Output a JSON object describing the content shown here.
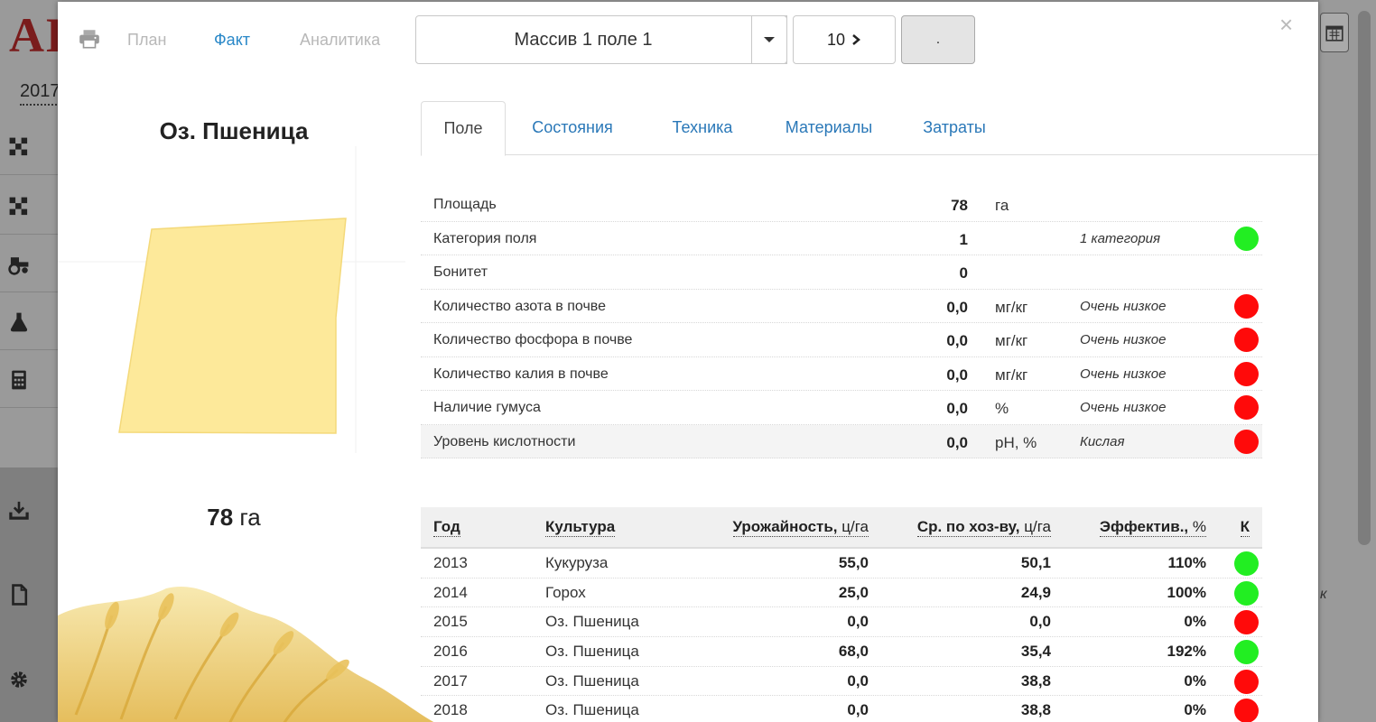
{
  "background": {
    "logo": "АК",
    "year": "2017",
    "side_note": "к"
  },
  "topbar": {
    "nav": [
      "План",
      "Факт",
      "Аналитика"
    ],
    "active_nav": "Факт",
    "field_select": "Массив 1 поле 1",
    "number_button": "10",
    "dot_button": ".",
    "close": "×"
  },
  "left_panel": {
    "crop": "Оз. Пшеница",
    "area_value": "78",
    "area_unit": "га",
    "field_color": "#fde99a"
  },
  "tabs": [
    "Поле",
    "Состояния",
    "Техника",
    "Материалы",
    "Затраты"
  ],
  "active_tab": "Поле",
  "properties": [
    {
      "label": "Площадь",
      "value": "78",
      "unit": "га",
      "note": "",
      "status": ""
    },
    {
      "label": "Категория поля",
      "value": "1",
      "unit": "",
      "note": "1 категория",
      "status": "green"
    },
    {
      "label": "Бонитет",
      "value": "0",
      "unit": "",
      "note": "",
      "status": ""
    },
    {
      "label": "Количество азота в почве",
      "value": "0,0",
      "unit": "мг/кг",
      "note": "Очень низкое",
      "status": "red"
    },
    {
      "label": "Количество фосфора в почве",
      "value": "0,0",
      "unit": "мг/кг",
      "note": "Очень низкое",
      "status": "red"
    },
    {
      "label": "Количество калия в почве",
      "value": "0,0",
      "unit": "мг/кг",
      "note": "Очень низкое",
      "status": "red"
    },
    {
      "label": "Наличие гумуса",
      "value": "0,0",
      "unit": "%",
      "note": "Очень низкое",
      "status": "red"
    },
    {
      "label": "Уровень кислотности",
      "value": "0,0",
      "unit": "pH, %",
      "note": "Кислая",
      "status": "red"
    }
  ],
  "yield_table": {
    "headers": {
      "year": "Год",
      "crop": "Культура",
      "yield": "Урожайность,",
      "yield_unit": " ц/га",
      "avg": "Ср. по хоз-ву,",
      "avg_unit": " ц/га",
      "eff": "Эффектив.,",
      "eff_unit": " %",
      "k": "К"
    },
    "rows": [
      {
        "year": "2013",
        "crop": "Кукуруза",
        "yield": "55,0",
        "avg": "50,1",
        "eff": "110%",
        "status": "green"
      },
      {
        "year": "2014",
        "crop": "Горох",
        "yield": "25,0",
        "avg": "24,9",
        "eff": "100%",
        "status": "green"
      },
      {
        "year": "2015",
        "crop": "Оз. Пшеница",
        "yield": "0,0",
        "avg": "0,0",
        "eff": "0%",
        "status": "red"
      },
      {
        "year": "2016",
        "crop": "Оз. Пшеница",
        "yield": "68,0",
        "avg": "35,4",
        "eff": "192%",
        "status": "green"
      },
      {
        "year": "2017",
        "crop": "Оз. Пшеница",
        "yield": "0,0",
        "avg": "38,8",
        "eff": "0%",
        "status": "red"
      },
      {
        "year": "2018",
        "crop": "Оз. Пшеница",
        "yield": "0,0",
        "avg": "38,8",
        "eff": "0%",
        "status": "red"
      }
    ]
  },
  "colors": {
    "accent": "#2a88c8",
    "status_green": "#22ee22",
    "status_red": "#ff0a0a"
  }
}
